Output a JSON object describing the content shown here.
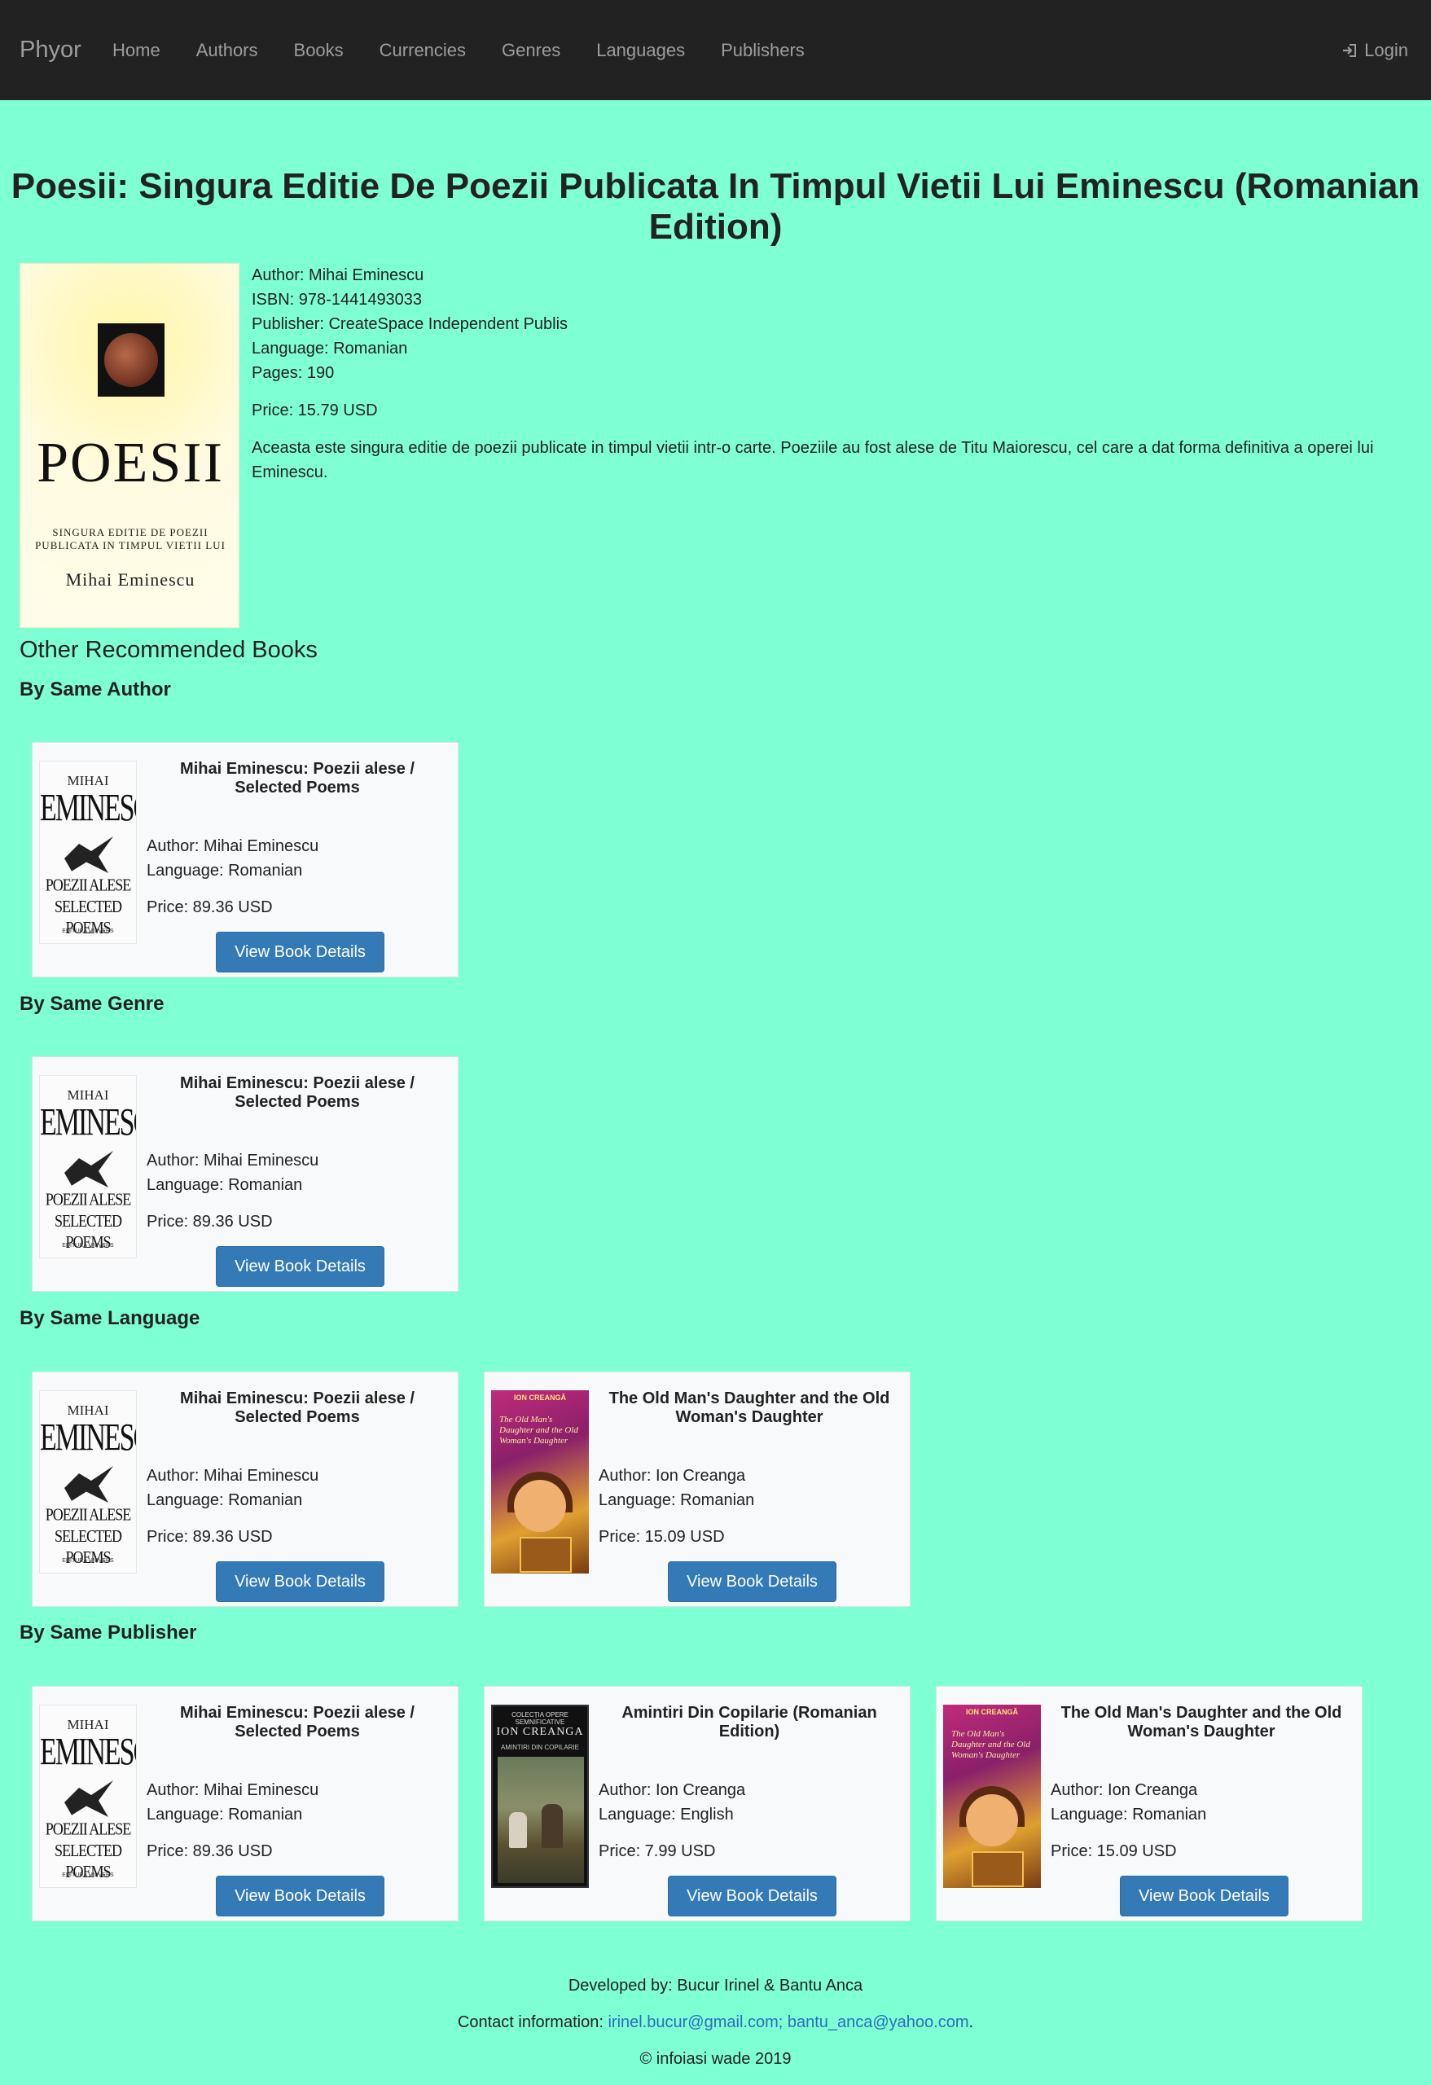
{
  "navbar": {
    "brand": "Phyor",
    "links": [
      "Home",
      "Authors",
      "Books",
      "Currencies",
      "Genres",
      "Languages",
      "Publishers"
    ],
    "login": "Login"
  },
  "book": {
    "title": "Poesii: Singura Editie De Poezii Publicata In Timpul Vietii Lui Eminescu (Romanian Edition)",
    "cover": {
      "title": "POESII",
      "subtitle_line1": "Singura editie de poezii",
      "subtitle_line2": "publicata in timpul vietii lui",
      "author": "Mihai Eminescu"
    },
    "author": "Author: Mihai Eminescu",
    "isbn": "ISBN: 978-1441493033",
    "publisher": "Publisher: CreateSpace Independent Publis",
    "language": "Language: Romanian",
    "pages": "Pages: 190",
    "price": "Price: 15.79 USD",
    "description": "Aceasta este singura editie de poezii publicate in timpul vietii intr-o carte. Poeziile au fost alese de Titu Maiorescu, cel care a dat forma definitiva a operei lui Eminescu."
  },
  "recommended": {
    "heading": "Other Recommended Books",
    "button_label": "View Book Details",
    "sections": [
      {
        "title": "By Same Author",
        "cards": [
          {
            "cover": "emin",
            "title": "Mihai Eminescu: Poezii alese / Selected Poems",
            "author": "Author: Mihai Eminescu",
            "language": "Language: Romanian",
            "price": "Price: 89.36 USD"
          }
        ]
      },
      {
        "title": "By Same Genre",
        "cards": [
          {
            "cover": "emin",
            "title": "Mihai Eminescu: Poezii alese / Selected Poems",
            "author": "Author: Mihai Eminescu",
            "language": "Language: Romanian",
            "price": "Price: 89.36 USD"
          }
        ]
      },
      {
        "title": "By Same Language",
        "cards": [
          {
            "cover": "emin",
            "title": "Mihai Eminescu: Poezii alese / Selected Poems",
            "author": "Author: Mihai Eminescu",
            "language": "Language: Romanian",
            "price": "Price: 89.36 USD"
          },
          {
            "cover": "old",
            "title": "The Old Man's Daughter and the Old Woman's Daughter",
            "author": "Author: Ion Creanga",
            "language": "Language: Romanian",
            "price": "Price: 15.09 USD"
          }
        ]
      },
      {
        "title": "By Same Publisher",
        "cards": [
          {
            "cover": "emin",
            "title": "Mihai Eminescu: Poezii alese / Selected Poems",
            "author": "Author: Mihai Eminescu",
            "language": "Language: Romanian",
            "price": "Price: 89.36 USD"
          },
          {
            "cover": "amin",
            "title": "Amintiri Din Copilarie (Romanian Edition)",
            "author": "Author: Ion Creanga",
            "language": "Language: English",
            "price": "Price: 7.99 USD"
          },
          {
            "cover": "old",
            "title": "The Old Man's Daughter and the Old Woman's Daughter",
            "author": "Author: Ion Creanga",
            "language": "Language: Romanian",
            "price": "Price: 15.09 USD"
          }
        ]
      }
    ]
  },
  "cover_text": {
    "emin": {
      "top": "MIHAI",
      "name": "EMINESCU",
      "line1": "POEZII ALESE",
      "line2": "SELECTED POEMS",
      "imprint": "EDITURA UNIVERS"
    },
    "old": {
      "top": "ION CREANGĂ",
      "title": "The Old Man's Daughter and the Old Woman's Daughter"
    },
    "amin": {
      "series": "COLECȚIA OPERE SEMNIFICATIVE",
      "author": "ION CREANGA",
      "title": "AMINTIRI DIN COPILARIE"
    }
  },
  "footer": {
    "developed": "Developed by: Bucur Irinel & Bantu Anca",
    "contact_label": "Contact information:",
    "contact_emails": "irinel.bucur@gmail.com; bantu_anca@yahoo.com",
    "contact_end": ".",
    "copyright": "© infoiasi wade 2019"
  },
  "colors": {
    "background": "#7fffd4",
    "navbar": "#222222",
    "button": "#337ab7",
    "link": "#2a6ebb"
  }
}
